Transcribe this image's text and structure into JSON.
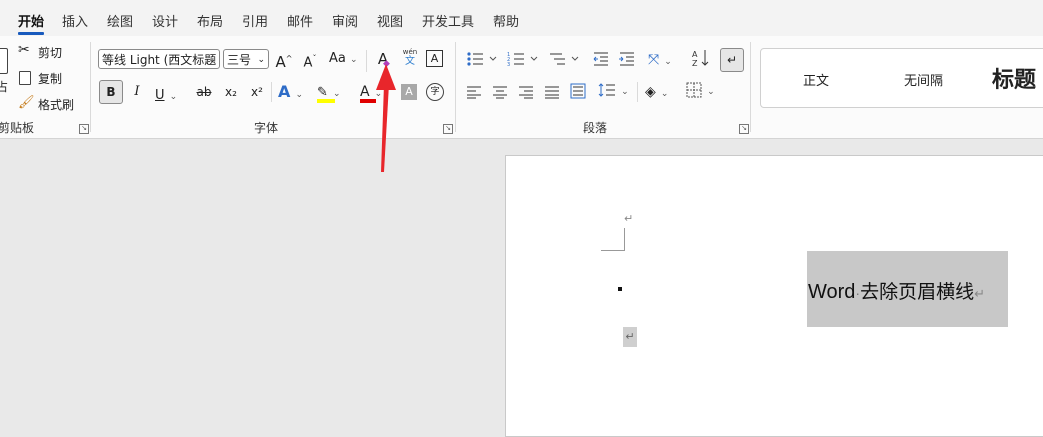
{
  "tabs": [
    "开始",
    "插入",
    "绘图",
    "设计",
    "布局",
    "引用",
    "邮件",
    "审阅",
    "视图",
    "开发工具",
    "帮助"
  ],
  "clipboard": {
    "cut": "剪切",
    "copy": "复制",
    "format_painter": "格式刷",
    "paste_fragment": "占",
    "group_label": "剪贴板"
  },
  "font": {
    "name": "等线 Light (西文标题",
    "size": "三号",
    "case_label": "Aa",
    "grow_label": "A",
    "shrink_label": "A",
    "clear_format_label": "A",
    "phonetic_top": "wén",
    "phonetic_bottom": "文",
    "char_border_label": "A",
    "bold": "B",
    "italic": "I",
    "underline": "U",
    "strike": "ab",
    "subscript": "x₂",
    "superscript": "x²",
    "text_effect": "A",
    "highlight": "✎",
    "font_color": "A",
    "char_shading": "A",
    "enclose": "字",
    "group_label": "字体",
    "colors": {
      "highlight": "#ffff00",
      "font_color": "#e00000",
      "text_effect": "#2e6cc7"
    }
  },
  "paragraph": {
    "group_label": "段落"
  },
  "styles": {
    "items": [
      "正文",
      "无间隔",
      "标题"
    ]
  },
  "document": {
    "paragraph_mark": "↵",
    "header_text": "Word",
    "header_text_dot": "·",
    "header_text_rest": "去除页眉横线"
  },
  "annotation": {
    "arrow_color": "#e8262b"
  }
}
